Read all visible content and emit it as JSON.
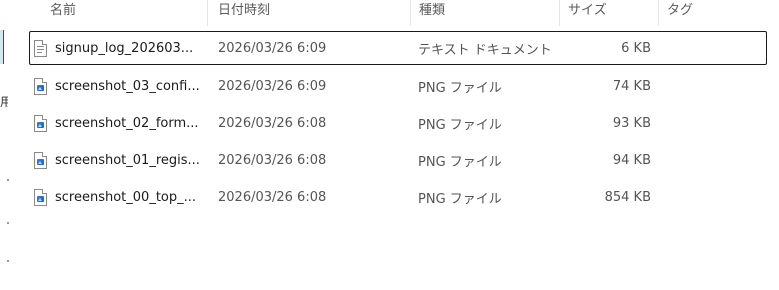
{
  "nav_edge": {
    "partial_glyph": "用"
  },
  "columns": [
    {
      "key": "name",
      "label": "名前"
    },
    {
      "key": "date",
      "label": "日付時刻"
    },
    {
      "key": "type",
      "label": "種類"
    },
    {
      "key": "size",
      "label": "サイズ"
    },
    {
      "key": "tag",
      "label": "タグ"
    }
  ],
  "files": [
    {
      "name": "signup_log_202603...",
      "date": "2026/03/26 6:09",
      "type": "テキスト ドキュメント",
      "size": "6 KB",
      "icon": "text-file-icon",
      "focused": true
    },
    {
      "name": "screenshot_03_confi...",
      "date": "2026/03/26 6:09",
      "type": "PNG ファイル",
      "size": "74 KB",
      "icon": "png-file-icon",
      "focused": false
    },
    {
      "name": "screenshot_02_form...",
      "date": "2026/03/26 6:08",
      "type": "PNG ファイル",
      "size": "93 KB",
      "icon": "png-file-icon",
      "focused": false
    },
    {
      "name": "screenshot_01_regis...",
      "date": "2026/03/26 6:08",
      "type": "PNG ファイル",
      "size": "94 KB",
      "icon": "png-file-icon",
      "focused": false
    },
    {
      "name": "screenshot_00_top_...",
      "date": "2026/03/26 6:08",
      "type": "PNG ファイル",
      "size": "854 KB",
      "icon": "png-file-icon",
      "focused": false
    }
  ],
  "colors": {
    "focus_border": "#1a1a1a",
    "header_text": "#5a5a5a",
    "image_icon_accent": "#1e5fb5"
  }
}
